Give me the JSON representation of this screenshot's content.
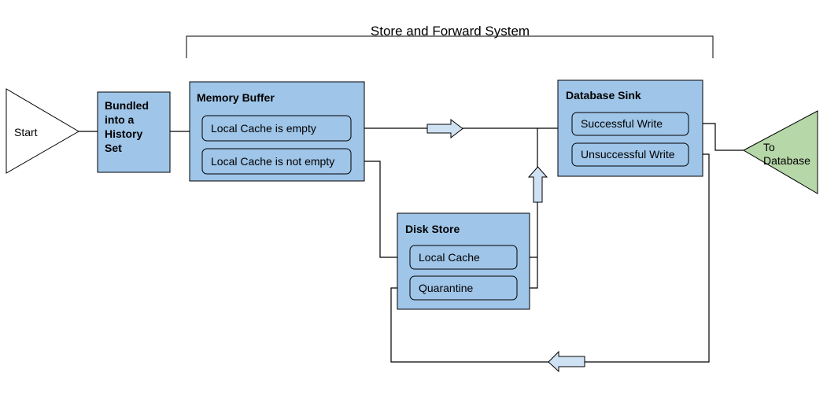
{
  "title": "Store and Forward System",
  "colors": {
    "box": "#9fc5e8",
    "arrow": "#cfe2f3",
    "end": "#b6d7a8",
    "start": "#ffffff"
  },
  "start": {
    "label": "Start"
  },
  "bundled": {
    "lines": [
      "Bundled",
      "into a",
      "History",
      "Set"
    ]
  },
  "memory_buffer": {
    "title": "Memory Buffer",
    "items": [
      "Local Cache is empty",
      "Local Cache is not empty"
    ]
  },
  "disk_store": {
    "title": "Disk Store",
    "items": [
      "Local Cache",
      "Quarantine"
    ]
  },
  "database_sink": {
    "title": "Database Sink",
    "items": [
      "Successful Write",
      "Unsuccessful Write"
    ]
  },
  "end": {
    "lines": [
      "To",
      "Database"
    ]
  }
}
